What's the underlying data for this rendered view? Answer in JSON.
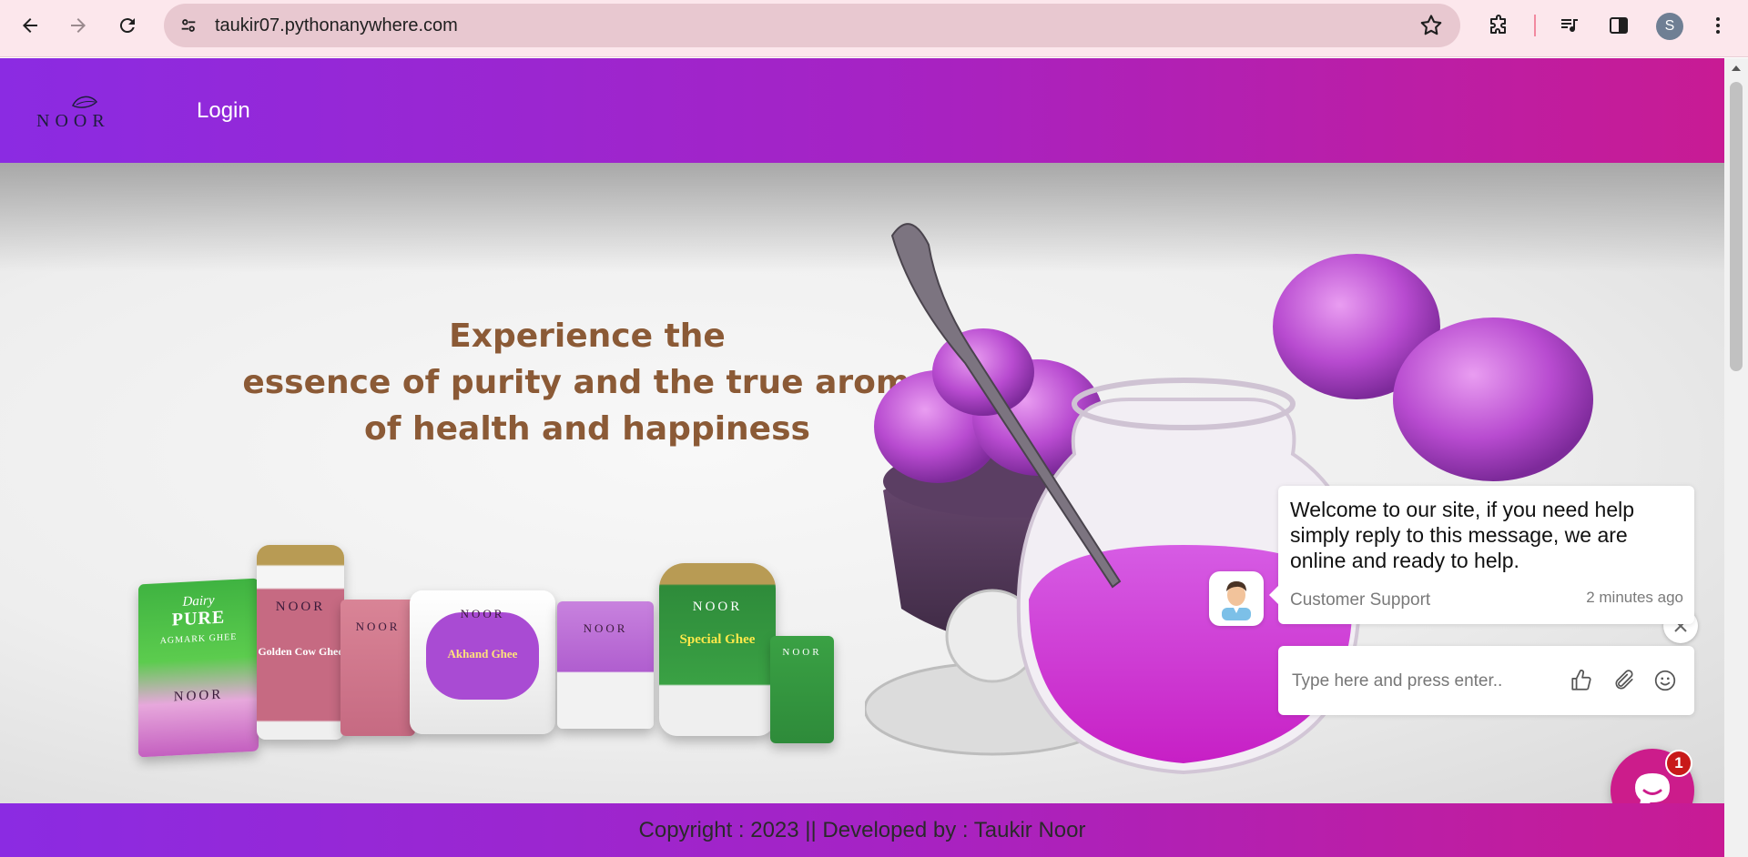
{
  "browser": {
    "url": "taukir07.pythonanywhere.com",
    "profile_initial": "S"
  },
  "site": {
    "logo_text": "NOOR",
    "nav": {
      "login_label": "Login"
    }
  },
  "hero": {
    "headline_line1": "Experience the",
    "headline_line2": "essence of purity and the true aroma",
    "headline_line3": "of health and happiness",
    "products": {
      "dairy_brand": "Dairy",
      "dairy_name": "PURE",
      "dairy_sub": "AGMARK GHEE",
      "pack_brand": "NOOR",
      "golden_label": "Golden Cow Ghee",
      "special_label": "Special Ghee",
      "akhand_label": "Akhand Ghee"
    }
  },
  "chat": {
    "message": "Welcome to our site, if you need help simply reply to this message, we are online and ready to help.",
    "author": "Customer Support",
    "time": "2 minutes ago",
    "input_placeholder": "Type here and press enter..",
    "unread_count": "1"
  },
  "footer": {
    "text": "Copyright : 2023 || Developed by : Taukir Noor"
  },
  "colors": {
    "header_gradient_start": "#8b2be2",
    "header_gradient_end": "#c81b94",
    "headline": "#8b5a36",
    "launcher": "#cc1c8b",
    "badge": "#c81919"
  }
}
